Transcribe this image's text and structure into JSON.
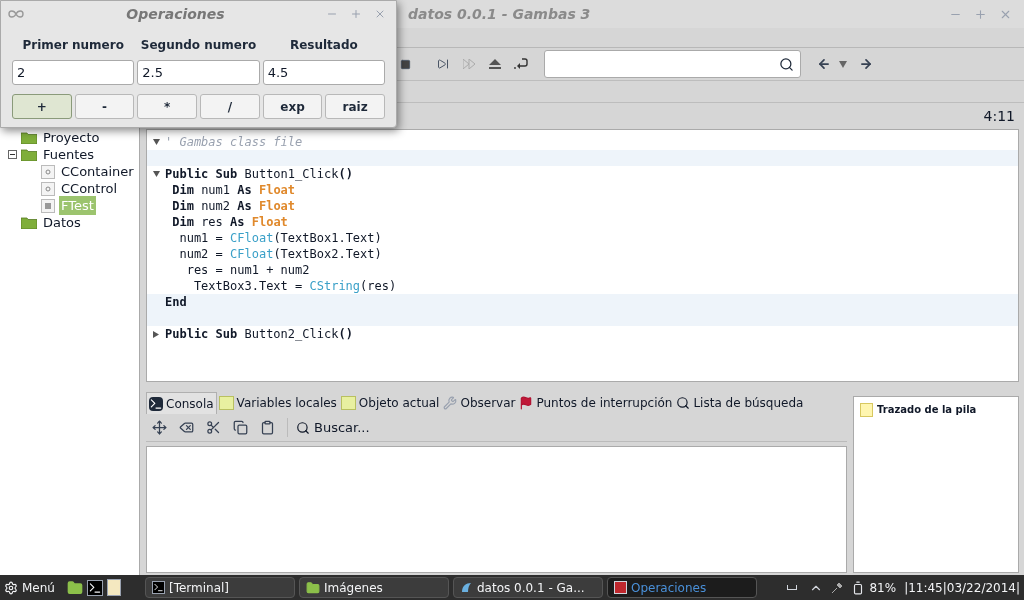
{
  "main_window": {
    "title": "datos 0.0.1 - Gambas 3",
    "position": "4:11"
  },
  "dialog": {
    "title": "Operaciones",
    "labels": [
      "Primer numero",
      "Segundo numero",
      "Resultado"
    ],
    "fields": [
      "2",
      "2.5",
      "4.5"
    ],
    "buttons": [
      {
        "label": "+",
        "selected": true
      },
      {
        "label": "-",
        "selected": false
      },
      {
        "label": "*",
        "selected": false
      },
      {
        "label": "/",
        "selected": false
      },
      {
        "label": "exp",
        "selected": false
      },
      {
        "label": "raiz",
        "selected": false
      }
    ]
  },
  "tree": [
    {
      "label": "Proyecto",
      "kind": "folder",
      "selected": false
    },
    {
      "label": "Fuentes",
      "kind": "folder",
      "expanded": true,
      "selected": false,
      "children": [
        {
          "label": "CContainer",
          "kind": "class",
          "selected": false
        },
        {
          "label": "CControl",
          "kind": "class",
          "selected": false
        },
        {
          "label": "FTest",
          "kind": "form",
          "selected": true
        }
      ]
    },
    {
      "label": "Datos",
      "kind": "folder",
      "selected": false
    }
  ],
  "editor": {
    "lines": [
      {
        "folded": false,
        "highlighted": false,
        "tokens": [
          {
            "text": "' Gambas class file",
            "kind": "comment"
          }
        ]
      },
      {
        "highlighted": true
      },
      {
        "folded": false,
        "highlighted": false,
        "tokens": [
          {
            "text": "Public Sub",
            "kind": "keyword"
          },
          {
            "text": " Button1_Click",
            "kind": "plain"
          },
          {
            "text": "()",
            "kind": "keyword"
          }
        ]
      },
      {
        "highlighted": false,
        "tokens": [
          {
            "text": " Dim",
            "kind": "keyword"
          },
          {
            "text": " num1 ",
            "kind": "plain"
          },
          {
            "text": "As",
            "kind": "keyword"
          },
          {
            "text": " Float",
            "kind": "type"
          }
        ]
      },
      {
        "highlighted": false,
        "tokens": [
          {
            "text": " Dim",
            "kind": "keyword"
          },
          {
            "text": " num2 ",
            "kind": "plain"
          },
          {
            "text": "As",
            "kind": "keyword"
          },
          {
            "text": " Float",
            "kind": "type"
          }
        ]
      },
      {
        "highlighted": false,
        "tokens": [
          {
            "text": " Dim",
            "kind": "keyword"
          },
          {
            "text": " res ",
            "kind": "plain"
          },
          {
            "text": "As",
            "kind": "keyword"
          },
          {
            "text": " Float",
            "kind": "type"
          }
        ]
      },
      {
        "highlighted": false,
        "tokens": [
          {
            "text": "  num1 = ",
            "kind": "plain"
          },
          {
            "text": "CFloat",
            "kind": "function"
          },
          {
            "text": "(TextBox1.Text)",
            "kind": "plain"
          }
        ]
      },
      {
        "highlighted": false,
        "tokens": [
          {
            "text": "  num2 = ",
            "kind": "plain"
          },
          {
            "text": "CFloat",
            "kind": "function"
          },
          {
            "text": "(TextBox2.Text)",
            "kind": "plain"
          }
        ]
      },
      {
        "highlighted": false,
        "tokens": [
          {
            "text": "   res = num1 + num2",
            "kind": "plain"
          }
        ]
      },
      {
        "highlighted": false,
        "tokens": [
          {
            "text": "    TextBox3.Text = ",
            "kind": "plain"
          },
          {
            "text": "CString",
            "kind": "function"
          },
          {
            "text": "(res)",
            "kind": "plain"
          }
        ]
      },
      {
        "highlighted": true,
        "tokens": [
          {
            "text": "End",
            "kind": "keyword"
          }
        ]
      },
      {
        "highlighted": true
      },
      {
        "folded": true,
        "highlighted": false,
        "tokens": [
          {
            "text": "Public Sub",
            "kind": "keyword"
          },
          {
            "text": " Button2_Click",
            "kind": "plain"
          },
          {
            "text": "()",
            "kind": "keyword"
          }
        ]
      }
    ]
  },
  "bottom_tabs": [
    {
      "label": "Consola",
      "kind": "terminal",
      "selected": true
    },
    {
      "label": "Variables locales",
      "kind": "dim",
      "selected": false
    },
    {
      "label": "Objeto actual",
      "kind": "me",
      "selected": false
    },
    {
      "label": "Observar",
      "kind": "wrench",
      "selected": false
    },
    {
      "label": "Puntos de interrupción",
      "kind": "flag",
      "selected": false
    },
    {
      "label": "Lista de búsqueda",
      "kind": "search",
      "selected": false
    }
  ],
  "console_toolbar": {
    "search_button": "Buscar..."
  },
  "stack_panel": {
    "title": "Trazado de la pila"
  },
  "taskbar": {
    "menu": "Menú",
    "tasks": [
      {
        "label": "[Terminal]",
        "kind": "terminal",
        "selected": false
      },
      {
        "label": "Imágenes",
        "kind": "folder",
        "selected": false
      },
      {
        "label": "datos 0.0.1 - Ga...",
        "kind": "gambas",
        "selected": false
      },
      {
        "label": "Operaciones",
        "kind": "app",
        "selected": true
      }
    ],
    "battery": "81%",
    "clock": "|11:45|03/22/2014|"
  }
}
